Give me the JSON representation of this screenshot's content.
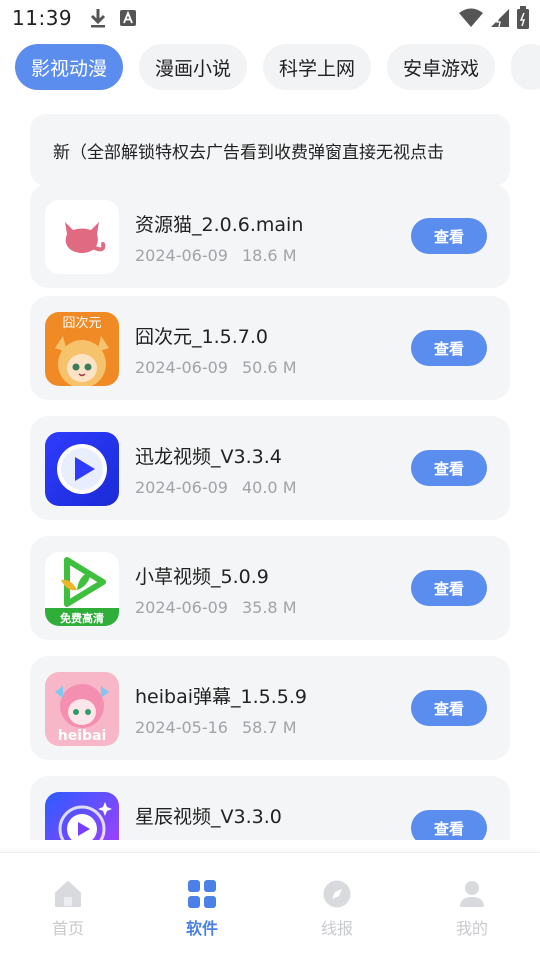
{
  "status_bar": {
    "time": "11:39",
    "left_icons": [
      "download-icon",
      "font-app-icon"
    ],
    "right_icons": [
      "wifi-icon",
      "signal-icon",
      "battery-icon"
    ]
  },
  "tabs": [
    {
      "label": "影视动漫",
      "active": true
    },
    {
      "label": "漫画小说",
      "active": false
    },
    {
      "label": "科学上网",
      "active": false
    },
    {
      "label": "安卓游戏",
      "active": false
    }
  ],
  "notice": "新（全部解锁特权去广告看到收费弹窗直接无视点击",
  "apps": [
    {
      "name": "资源猫_2.0.6.main",
      "date": "2024-06-09",
      "size": "18.6 M",
      "button": "查看",
      "icon": "cat-icon"
    },
    {
      "name": "囧次元_1.5.7.0",
      "date": "2024-06-09",
      "size": "50.6 M",
      "button": "查看",
      "icon": "anime-girl-icon",
      "icon_text": "囧次元"
    },
    {
      "name": "迅龙视频_V3.3.4",
      "date": "2024-06-09",
      "size": "40.0 M",
      "button": "查看",
      "icon": "play-circle-icon"
    },
    {
      "name": "小草视频_5.0.9",
      "date": "2024-06-09",
      "size": "35.8 M",
      "button": "查看",
      "icon": "grass-play-icon",
      "icon_text": "免费高清"
    },
    {
      "name": "heibai弹幕_1.5.5.9",
      "date": "2024-05-16",
      "size": "58.7 M",
      "button": "查看",
      "icon": "pink-girl-icon",
      "icon_text": "heibai"
    },
    {
      "name": "星辰视频_V3.3.0",
      "date": "",
      "size": "",
      "button": "查看",
      "icon": "star-play-icon"
    }
  ],
  "bottom_nav": [
    {
      "label": "首页",
      "icon": "home-icon",
      "active": false
    },
    {
      "label": "软件",
      "icon": "apps-grid-icon",
      "active": true
    },
    {
      "label": "线报",
      "icon": "compass-icon",
      "active": false
    },
    {
      "label": "我的",
      "icon": "user-icon",
      "active": false
    }
  ],
  "colors": {
    "accent": "#5b8def",
    "card_bg": "#f4f5f7",
    "meta_text": "#a0a3a8",
    "nav_inactive": "#c8cacd"
  }
}
